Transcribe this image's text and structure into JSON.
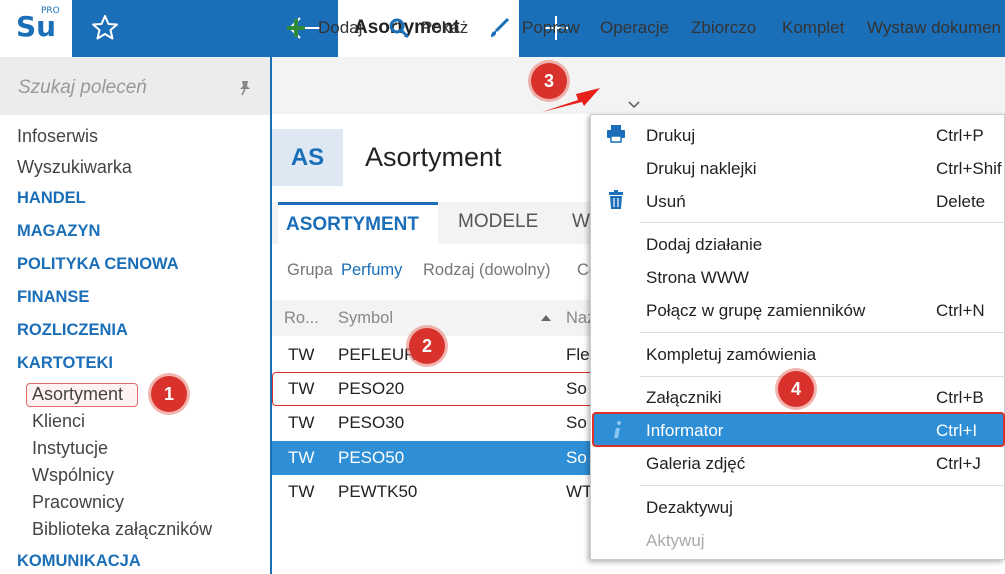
{
  "app": {
    "logo_main": "Su",
    "logo_sup": "PRO",
    "tab_title": "Asortyment"
  },
  "sidebar": {
    "search_placeholder": "Szukaj poleceń",
    "items": [
      {
        "label": "Infoserwis",
        "type": "item"
      },
      {
        "label": "Wyszukiwarka",
        "type": "item"
      },
      {
        "label": "HANDEL",
        "type": "category"
      },
      {
        "label": "MAGAZYN",
        "type": "category"
      },
      {
        "label": "POLITYKA CENOWA",
        "type": "category"
      },
      {
        "label": "FINANSE",
        "type": "category"
      },
      {
        "label": "ROZLICZENIA",
        "type": "category"
      },
      {
        "label": "KARTOTEKI",
        "type": "category"
      },
      {
        "label": "Asortyment",
        "type": "subitem",
        "selected": true
      },
      {
        "label": "Klienci",
        "type": "subitem"
      },
      {
        "label": "Instytucje",
        "type": "subitem"
      },
      {
        "label": "Wspólnicy",
        "type": "subitem"
      },
      {
        "label": "Pracownicy",
        "type": "subitem"
      },
      {
        "label": "Biblioteka załączników",
        "type": "subitem"
      },
      {
        "label": "KOMUNIKACJA",
        "type": "category"
      }
    ]
  },
  "toolbar": {
    "add": "Dodaj",
    "show": "Pokaż",
    "edit": "Popraw",
    "operations": "Operacje",
    "collections": "Zbiorczo",
    "set": "Komplet",
    "issue_doc": "Wystaw dokumen"
  },
  "header": {
    "badge": "AS",
    "title": "Asortyment"
  },
  "tabs": [
    "ASORTYMENT",
    "MODELE",
    "W"
  ],
  "filters": {
    "group_label": "Grupa",
    "group_value": "Perfumy",
    "type_label": "Rodzaj (dowolny)",
    "more": "Ce"
  },
  "grid": {
    "columns": [
      "Ro...",
      "Symbol",
      "Naz"
    ],
    "rows": [
      {
        "type": "TW",
        "symbol": "PEFLEUR15",
        "name": "Fleu"
      },
      {
        "type": "TW",
        "symbol": "PESO20",
        "name": "So"
      },
      {
        "type": "TW",
        "symbol": "PESO30",
        "name": "So"
      },
      {
        "type": "TW",
        "symbol": "PESO50",
        "name": "So"
      },
      {
        "type": "TW",
        "symbol": "PEWTK50",
        "name": "WT"
      }
    ]
  },
  "menu": {
    "items": [
      {
        "label": "Drukuj",
        "shortcut": "Ctrl+P",
        "icon": "printer-icon"
      },
      {
        "label": "Drukuj naklejki",
        "shortcut": "Ctrl+Shif"
      },
      {
        "label": "Usuń",
        "shortcut": "Delete",
        "icon": "trash-icon"
      },
      {
        "label": "Dodaj działanie",
        "shortcut": ""
      },
      {
        "label": "Strona WWW",
        "shortcut": ""
      },
      {
        "label": "Połącz w grupę zamienników",
        "shortcut": "Ctrl+N"
      },
      {
        "label": "Kompletuj zamówienia",
        "shortcut": ""
      },
      {
        "label": "Załączniki",
        "shortcut": "Ctrl+B"
      },
      {
        "label": "Informator",
        "shortcut": "Ctrl+I",
        "icon": "info-icon",
        "highlighted": true
      },
      {
        "label": "Galeria zdjęć",
        "shortcut": "Ctrl+J"
      },
      {
        "label": "Dezaktywuj",
        "shortcut": ""
      },
      {
        "label": "Aktywuj",
        "shortcut": "",
        "disabled": true
      }
    ]
  },
  "annotations": [
    "1",
    "2",
    "3",
    "4"
  ],
  "colors": {
    "brand": "#1b6fb8",
    "selection": "#2e8fd6",
    "annotation": "#d9312b"
  }
}
